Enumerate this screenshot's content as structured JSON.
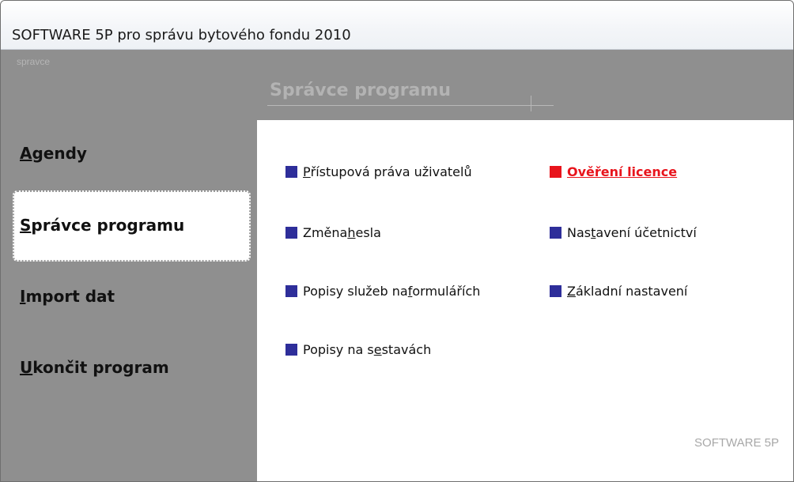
{
  "window": {
    "title": "SOFTWARE 5P pro správu bytového fondu 2010"
  },
  "user": {
    "name": "spravce"
  },
  "section": {
    "title": "Správce programu"
  },
  "nav": {
    "items": [
      {
        "key": "A",
        "rest": "gendy",
        "active": false
      },
      {
        "key": "S",
        "rest": "právce programu",
        "active": true
      },
      {
        "key": "I",
        "rest": "mport dat",
        "active": false
      },
      {
        "key": "U",
        "rest": "končit program",
        "active": false
      }
    ]
  },
  "links": {
    "pristupova_prava": {
      "pre": "",
      "key": "P",
      "post": "řístupová práva uživatelů"
    },
    "zmena_hesla": {
      "pre": "Změna ",
      "key": "h",
      "post": "esla"
    },
    "popisy_sluzeb": {
      "pre": "Popisy služeb na ",
      "key": "f",
      "post": "ormulářích"
    },
    "popisy_sestav": {
      "pre": "Popisy na s",
      "key": "e",
      "post": "stavách"
    },
    "overeni_licence": {
      "pre": "",
      "key": "Ověření licence",
      "post": ""
    },
    "nastaveni_ucetnictvi": {
      "pre": "Nas",
      "key": "t",
      "post": "avení účetnictví"
    },
    "zakladni_nastaveni": {
      "pre": "",
      "key": "Z",
      "post": "ákladní nastavení"
    }
  },
  "colors": {
    "link_square": "#2e2e9a",
    "alert": "#e8141c",
    "sidebar": "#8f8f8f"
  },
  "footer": {
    "brand": "SOFTWARE 5P"
  }
}
